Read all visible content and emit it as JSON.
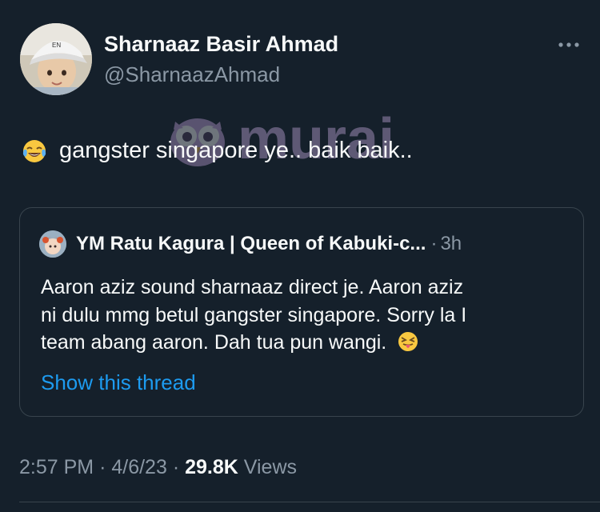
{
  "author": {
    "name": "Sharnaaz Basir Ahmad",
    "handle": "@SharnaazAhmad"
  },
  "tweet": {
    "emoji": "face-with-tears-of-joy",
    "text": "gangster singapore ye.. baik baik.."
  },
  "watermark": {
    "text": "murai"
  },
  "quoted_tweet": {
    "author_name": "YM Ratu Kagura | Queen of Kabuki-c...",
    "separator": "·",
    "time": "3h",
    "lines": [
      "Aaron aziz sound sharnaaz direct je. Aaron aziz",
      "ni dulu mmg betul gangster singapore. Sorry la I",
      "team abang aaron. Dah tua pun wangi."
    ],
    "trailing_emoji": "squinting-face-with-tongue",
    "show_thread_label": "Show this thread"
  },
  "meta": {
    "time": "2:57 PM",
    "sep1": "·",
    "date": "4/6/23",
    "sep2": "·",
    "views_count": "29.8K",
    "views_label": "Views"
  },
  "colors": {
    "background": "#15202b",
    "primary_text": "#f7f9f9",
    "secondary_text": "#8b98a5",
    "link": "#1d9bf0",
    "border": "#38444d"
  }
}
